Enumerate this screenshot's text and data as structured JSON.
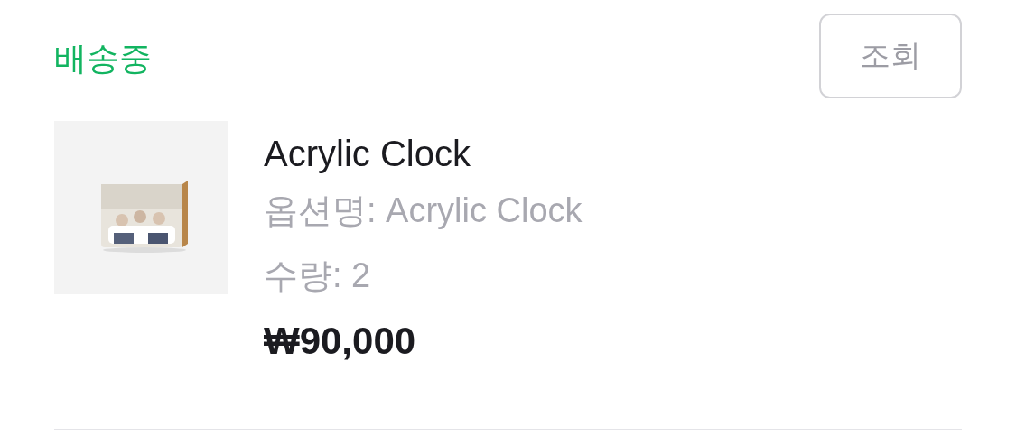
{
  "order": {
    "status": "배송중",
    "button": "조회"
  },
  "item": {
    "name": "Acrylic Clock",
    "option": "옵션명: Acrylic Clock",
    "quantity": "수량: 2",
    "price": "₩90,000"
  }
}
